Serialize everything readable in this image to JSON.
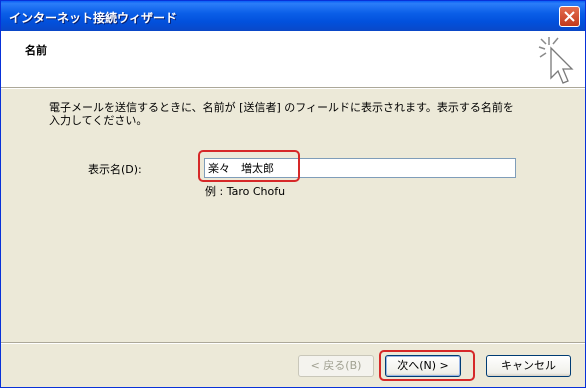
{
  "window": {
    "title": "インターネット接続ウィザード"
  },
  "header": {
    "title": "名前"
  },
  "body": {
    "description": "電子メールを送信するときに、名前が [送信者] のフィールドに表示されます。表示する名前を入力してください。",
    "display_name_label": "表示名(D):",
    "display_name_value": "楽々　増太郎",
    "example": "例 : Taro Chofu"
  },
  "buttons": {
    "back": "< 戻る(B)",
    "next": "次へ(N) >",
    "cancel": "キャンセル"
  },
  "icons": {
    "close": "close-icon",
    "wizard": "wizard-sparkle-cursor-icon"
  },
  "colors": {
    "titlebar": "#0a5ff5",
    "dialog_bg": "#ece9d8",
    "highlight": "#d62828"
  }
}
